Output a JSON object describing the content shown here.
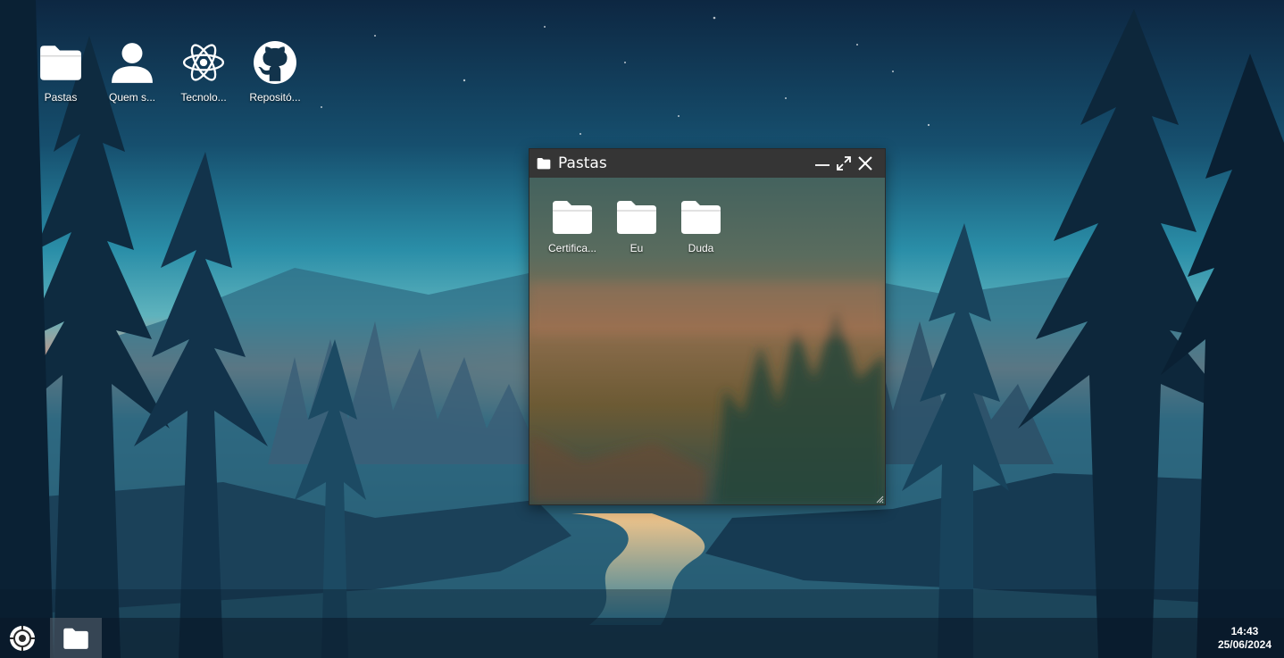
{
  "desktop": {
    "icons": [
      {
        "label": "Pastas",
        "icon": "folder-icon"
      },
      {
        "label": "Quem s...",
        "icon": "user-icon"
      },
      {
        "label": "Tecnolo...",
        "icon": "react-icon"
      },
      {
        "label": "Repositó...",
        "icon": "github-icon"
      }
    ]
  },
  "window": {
    "title": "Pastas",
    "title_icon": "folder-icon",
    "controls": [
      "minimize-icon",
      "maximize-icon",
      "close-icon"
    ],
    "items": [
      {
        "label": "Certifica...",
        "icon": "folder-icon"
      },
      {
        "label": "Eu",
        "icon": "folder-icon"
      },
      {
        "label": "Duda",
        "icon": "folder-icon"
      }
    ]
  },
  "taskbar": {
    "start_icon": "start-menu-icon",
    "apps": [
      {
        "icon": "folder-icon",
        "active": true
      }
    ],
    "clock": {
      "time": "14:43",
      "date": "25/06/2024"
    }
  },
  "colors": {
    "titlebar": "#353535",
    "text": "#ffffff",
    "sky_top": "#0d2a44",
    "sky_mid": "#2c8aa6",
    "glow": "#e4806a"
  }
}
